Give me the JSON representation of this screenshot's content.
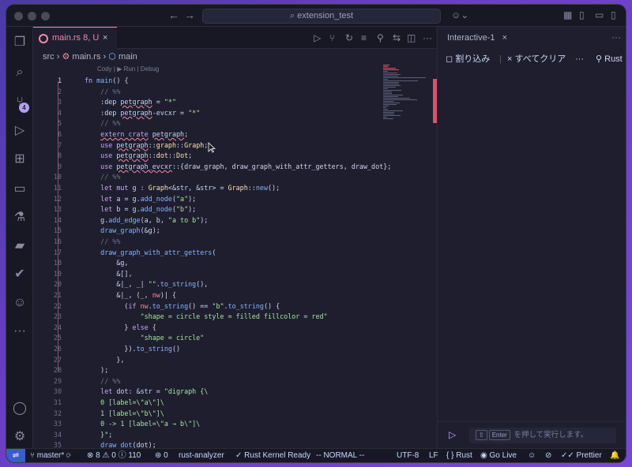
{
  "titlebar": {
    "search_text": "extension_test",
    "search_icon": "search-icon"
  },
  "activity_bar": {
    "items": [
      "explorer-icon",
      "search-icon",
      "source-control-icon",
      "run-debug-icon",
      "extensions-icon",
      "remote-explorer-icon",
      "testing-icon",
      "docker-icon",
      "check-icon",
      "copilot-icon",
      "more-icon",
      "account-icon",
      "settings-icon"
    ],
    "source_control_badge": "4"
  },
  "editor": {
    "tab": {
      "filename": "main.rs",
      "status": "8, U",
      "close": "×"
    },
    "breadcrumb": {
      "folder": "src",
      "sep": "›",
      "file": "main.rs",
      "symbol": "main"
    },
    "codelens": "Cody | ▶ Run | Debug",
    "lines": [
      {
        "n": "1",
        "html": "<span class=\"k\">fn</span> <span class=\"f\">main</span>() {"
      },
      {
        "n": "2",
        "html": "    <span class=\"c\">// %%</span>"
      },
      {
        "n": "3",
        "html": "    :dep <span class=\"sq\">petgraph</span> = <span class=\"s\">\"*\"</span>"
      },
      {
        "n": "4",
        "html": "    :dep <span class=\"sq\">petgraph</span>-evcxr = <span class=\"s\">\"*\"</span>"
      },
      {
        "n": "5",
        "html": "    <span class=\"c\">// %%</span>"
      },
      {
        "n": "6",
        "html": "    <span class=\"k sq\">extern crate</span> <span class=\"sq\">petgraph</span>;"
      },
      {
        "n": "7",
        "html": "    <span class=\"k\">use</span> <span class=\"sq\">petgraph</span>::<span class=\"t\">graph</span>::<span class=\"t\">Graph</span>;"
      },
      {
        "n": "8",
        "html": "    <span class=\"k\">use</span> <span class=\"sq\">petgraph</span>::<span class=\"t\">dot</span>::<span class=\"t\">Dot</span>;"
      },
      {
        "n": "9",
        "html": "    <span class=\"k\">use</span> <span class=\"sq\">petgraph_evcxr</span>::{draw_graph, draw_graph_with_attr_getters, draw_dot};"
      },
      {
        "n": "10",
        "html": "    <span class=\"c\">// %%</span>"
      },
      {
        "n": "11",
        "html": "    <span class=\"k\">let mut</span> g : <span class=\"t\">Graph</span>&lt;&amp;str, &amp;str&gt; = <span class=\"t\">Graph</span>::<span class=\"f\">new</span>();"
      },
      {
        "n": "12",
        "html": "    <span class=\"k\">let</span> a = g.<span class=\"f\">add_node</span>(<span class=\"s\">\"a\"</span>);"
      },
      {
        "n": "13",
        "html": "    <span class=\"k\">let</span> b = g.<span class=\"f\">add_node</span>(<span class=\"s\">\"b\"</span>);"
      },
      {
        "n": "14",
        "html": "    g.<span class=\"f\">add_edge</span>(a, b, <span class=\"s\">\"a to b\"</span>);"
      },
      {
        "n": "15",
        "html": "    <span class=\"f\">draw_graph</span>(&amp;g);"
      },
      {
        "n": "16",
        "html": "    <span class=\"c\">// %%</span>"
      },
      {
        "n": "17",
        "html": "    <span class=\"f\">draw_graph_with_attr_getters</span>("
      },
      {
        "n": "18",
        "html": "        &amp;g,"
      },
      {
        "n": "19",
        "html": "        &amp;[],"
      },
      {
        "n": "20",
        "html": "        &amp;|_, _| <span class=\"s\">\"\"</span>.<span class=\"f\">to_string</span>(),"
      },
      {
        "n": "21",
        "html": "        &amp;|_, (_, <span class=\"p\">nw</span>)| {"
      },
      {
        "n": "22",
        "html": "          (<span class=\"k\">if</span> <span class=\"p\">nw</span>.<span class=\"f\">to_string</span>() == <span class=\"s\">\"b\"</span>.<span class=\"f\">to_string</span>() {"
      },
      {
        "n": "23",
        "html": "              <span class=\"s\">\"shape = circle style = filled fillcolor = red\"</span>"
      },
      {
        "n": "24",
        "html": "          } <span class=\"k\">else</span> {"
      },
      {
        "n": "25",
        "html": "              <span class=\"s\">\"shape = circle\"</span>"
      },
      {
        "n": "26",
        "html": "          }).<span class=\"f\">to_string</span>()"
      },
      {
        "n": "27",
        "html": "        },"
      },
      {
        "n": "28",
        "html": "    );"
      },
      {
        "n": "29",
        "html": "    <span class=\"c\">// %%</span>"
      },
      {
        "n": "30",
        "html": "    <span class=\"k\">let</span> dot: &amp;str = <span class=\"s\">\"digraph {\\</span>"
      },
      {
        "n": "31",
        "html": "<span class=\"s\">    0 [label=\\\"a\\\"]\\</span>"
      },
      {
        "n": "32",
        "html": "<span class=\"s\">    1 [label=\\\"b\\\"]\\</span>"
      },
      {
        "n": "33",
        "html": "<span class=\"s\">    0 -&gt; 1 [label=\\\"a → b\\\"]\\</span>"
      },
      {
        "n": "34",
        "html": "<span class=\"s\">    }\"</span>;"
      },
      {
        "n": "35",
        "html": "    <span class=\"f\">draw_dot</span>(dot);"
      }
    ]
  },
  "panel": {
    "tab_label": "Interactive-1",
    "toolbar": {
      "interrupt": "割り込み",
      "clear_all": "すべてクリア",
      "more": "···",
      "kernel": "Rust"
    },
    "input": {
      "key": "Enter",
      "placeholder": "を押して実行します。"
    }
  },
  "statusbar": {
    "branch": "master*",
    "errors": "8",
    "warnings": "0",
    "infos": "110",
    "ports": "0",
    "language_server": "rust-analyzer",
    "kernel": "Rust Kernel Ready",
    "mode": "-- NORMAL --",
    "encoding": "UTF-8",
    "eol": "LF",
    "language": "Rust",
    "go_live": "Go Live",
    "prettier": "Prettier"
  }
}
